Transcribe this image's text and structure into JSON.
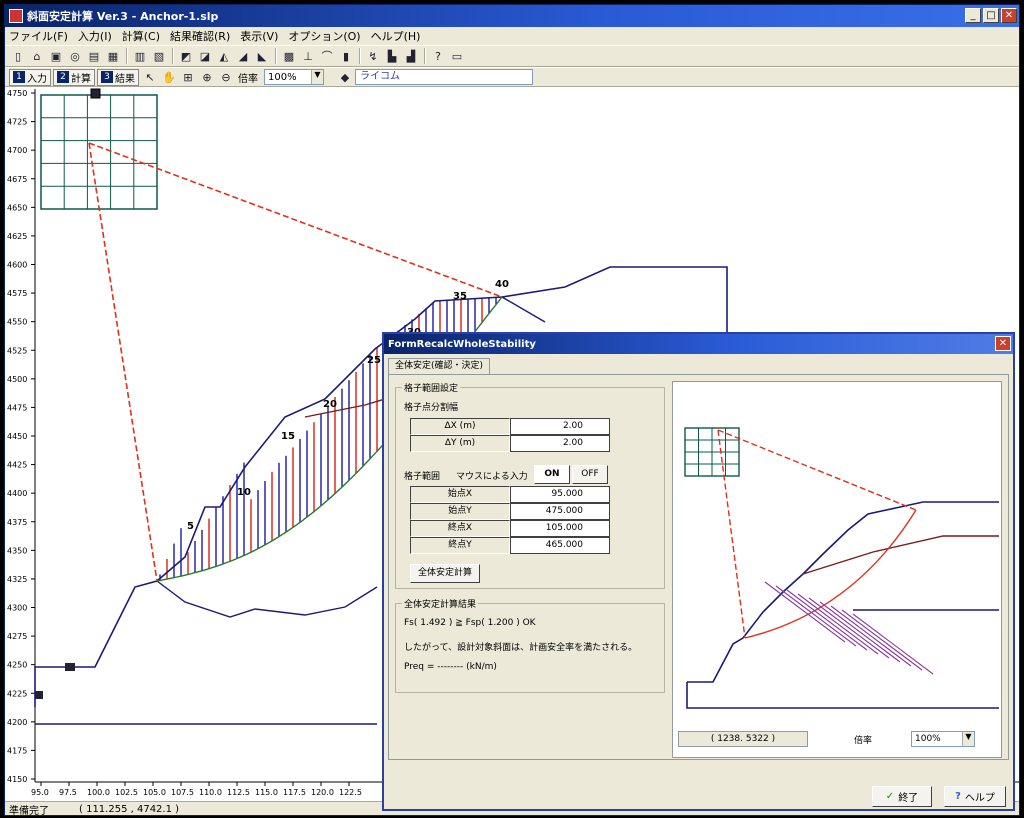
{
  "window": {
    "title": "斜面安定計算 Ver.3 - Anchor-1.slp",
    "minimize": "_",
    "maximize": "□",
    "close": "✕"
  },
  "menu": [
    "ファイル(F)",
    "入力(I)",
    "計算(C)",
    "結果確認(R)",
    "表示(V)",
    "オプション(O)",
    "ヘルプ(H)"
  ],
  "toolbar2": {
    "mode_buttons": [
      {
        "num": "1",
        "label": "入力"
      },
      {
        "num": "2",
        "label": "計算"
      },
      {
        "num": "3",
        "label": "結果"
      }
    ],
    "zoom_label": "倍率",
    "zoom_value": "100%",
    "company": "ライコム"
  },
  "canvas": {
    "y_ticks": [
      "4750",
      "4725",
      "4700",
      "4675",
      "4650",
      "4625",
      "4600",
      "4575",
      "4550",
      "4525",
      "4500",
      "4475",
      "4450",
      "4425",
      "4400",
      "4375",
      "4350",
      "4325",
      "4300",
      "4275",
      "4250",
      "4225",
      "4200",
      "4175",
      "4150"
    ],
    "x_ticks": [
      "95.0",
      "97.5",
      "100.0",
      "102.5",
      "105.0",
      "107.5",
      "110.0",
      "112.5",
      "115.0",
      "117.5",
      "120.0",
      "122.5"
    ],
    "slice_labels": [
      "5",
      "10",
      "15",
      "20",
      "25",
      "30",
      "35",
      "40"
    ],
    "colors": {
      "terrain": "#1a1a7a",
      "failure": "#e0301e",
      "slice_blue": "#1a1aa0",
      "slice_red": "#d82010",
      "grid": "#0b5a4a"
    }
  },
  "status": {
    "left": "準備完了",
    "coords": "( 111.255 , 4742.1 )"
  },
  "dialog": {
    "title": "FormRecalcWholeStability",
    "close": "✕",
    "tab": "全体安定(確認・決定)",
    "grid_group": "格子範囲設定",
    "grid_div_title": "格子点分割幅",
    "dx_label": "ΔX (m)",
    "dx_value": "2.00",
    "dy_label": "ΔY (m)",
    "dy_value": "2.00",
    "range_title": "格子範囲",
    "mouse_input": "マウスによる入力",
    "on_label": "ON",
    "off_label": "OFF",
    "start_x_label": "始点X",
    "start_x_value": "95.000",
    "start_y_label": "始点Y",
    "start_y_value": "475.000",
    "end_x_label": "終点X",
    "end_x_value": "105.000",
    "end_y_label": "終点Y",
    "end_y_value": "465.000",
    "run_button": "全体安定計算",
    "result_group": "全体安定計算結果",
    "result_line1": "Fs( 1.492 ) ≧ Fsp( 1.200 )   OK",
    "result_line2": "したがって、設計対象斜面は、計画安全率を満たされる。",
    "result_line3": "Preq = -------- (kN/m)",
    "preview_coords": "( 1238. 5322 )",
    "zoom_label": "倍率",
    "zoom_value": "100%",
    "ok_button": "終了",
    "help_button": "ヘルプ"
  }
}
